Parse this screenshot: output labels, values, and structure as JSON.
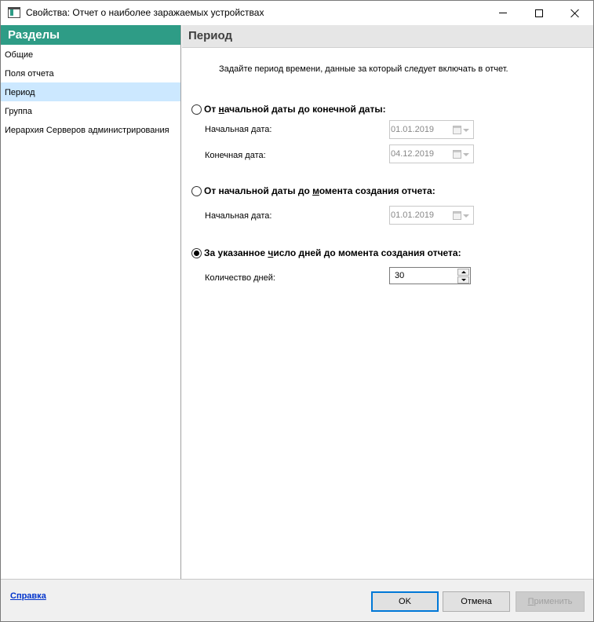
{
  "window": {
    "title": "Свойства: Отчет о наиболее заражаемых устройствах"
  },
  "sidebar": {
    "header": "Разделы",
    "items": [
      {
        "label": "Общие",
        "selected": false
      },
      {
        "label": "Поля отчета",
        "selected": false
      },
      {
        "label": "Период",
        "selected": true
      },
      {
        "label": "Группа",
        "selected": false
      },
      {
        "label": "Иерархия Серверов администрирования",
        "selected": false
      }
    ]
  },
  "panel": {
    "title": "Период",
    "intro": "Задайте период времени, данные за который следует включать в отчет.",
    "option1": {
      "prefix": "От ",
      "hotkey": "н",
      "suffix": "ачальной даты до конечной даты:",
      "checked": false,
      "start_label": "Начальная дата:",
      "start_value": "01.01.2019",
      "end_label": "Конечная дата:",
      "end_value": "04.12.2019"
    },
    "option2": {
      "prefix": "От начальной даты до ",
      "hotkey": "м",
      "suffix": "омента создания отчета:",
      "checked": false,
      "start_label": "Начальная дата:",
      "start_value": "01.01.2019"
    },
    "option3": {
      "prefix": "За указанное ",
      "hotkey": "ч",
      "suffix": "исло дней до момента создания отчета:",
      "checked": true,
      "days_label": "Количество дней:",
      "days_value": "30"
    }
  },
  "footer": {
    "help": "Справка",
    "ok": "OK",
    "cancel": "Отмена",
    "apply_hotkey": "П",
    "apply_rest": "рименить"
  },
  "colors": {
    "accent": "#2e9c86",
    "selection": "#cce8ff",
    "link": "#0033cc"
  }
}
